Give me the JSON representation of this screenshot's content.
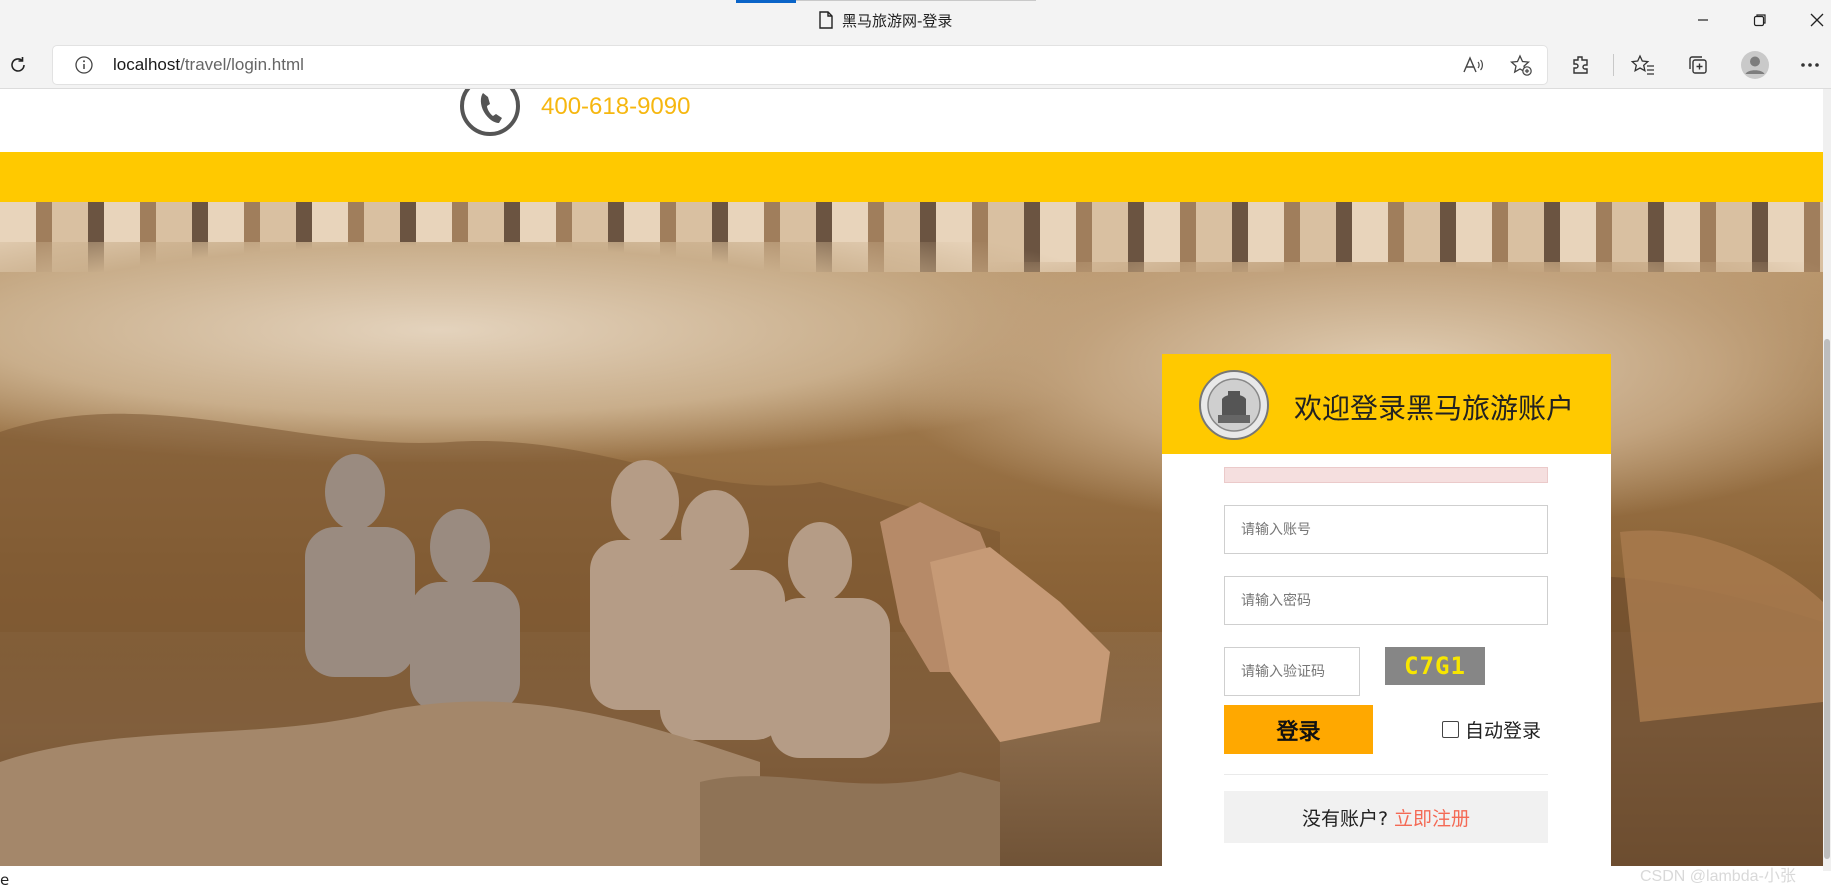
{
  "browser": {
    "tab_title": "黑马旅游网-登录",
    "url_host": "localhost",
    "url_path": "/travel/login.html"
  },
  "header": {
    "phone_number": "400-618-9090"
  },
  "colors": {
    "accent_yellow": "#ffc900",
    "login_button": "#ffa800",
    "register_link": "#f46a55",
    "phone_text": "#f6b710"
  },
  "login": {
    "title": "欢迎登录黑马旅游账户",
    "username_placeholder": "请输入账号",
    "password_placeholder": "请输入密码",
    "captcha_placeholder": "请输入验证码",
    "captcha_code": "C7G1",
    "login_button": "登录",
    "auto_login_label": "自动登录",
    "no_account_text": "没有账户?",
    "register_link": "立即注册"
  },
  "status": {
    "left_text": "e",
    "watermark": "CSDN @lambda-小张"
  },
  "icons": {
    "tab": "document-icon",
    "reload": "reload-icon",
    "site_info": "info-icon",
    "read_aloud": "read-aloud-icon",
    "add_favorite": "add-favorite-icon",
    "extensions": "extensions-icon",
    "favorites": "favorites-icon",
    "collections": "collections-icon",
    "profile": "profile-icon",
    "more": "more-icon",
    "phone": "phone-icon",
    "logo": "logo-icon"
  }
}
